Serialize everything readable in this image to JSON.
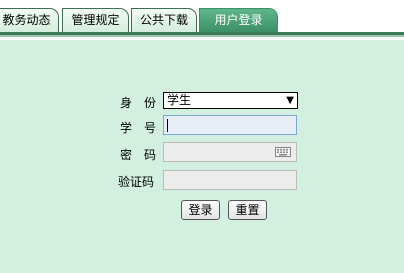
{
  "tabs": [
    {
      "label": "教务动态",
      "active": false
    },
    {
      "label": "管理规定",
      "active": false
    },
    {
      "label": "公共下载",
      "active": false
    },
    {
      "label": "用户登录",
      "active": true
    }
  ],
  "form": {
    "identity_label": "身　份",
    "identity_value": "学生",
    "student_id_label": "学　号",
    "student_id_value": "",
    "password_label": "密　码",
    "password_value": "",
    "captcha_label": "验证码",
    "captcha_value": ""
  },
  "buttons": {
    "login": "登录",
    "reset": "重置"
  },
  "icons": {
    "dropdown": "chevron-down-icon",
    "keyboard": "keyboard-icon"
  },
  "colors": {
    "background": "#d2efe0",
    "active_tab": "#4ea57a",
    "tab_border": "#3b7a58"
  }
}
